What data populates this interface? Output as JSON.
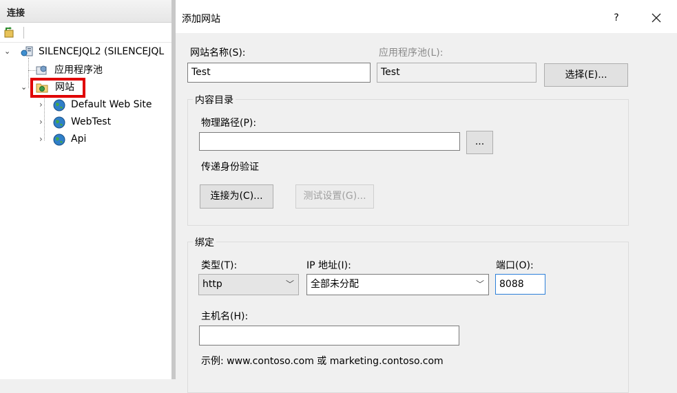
{
  "connections": {
    "header": "连接",
    "tree": {
      "server": "SILENCEJQL2 (SILENCEJQL",
      "app_pools": "应用程序池",
      "sites": "网站",
      "site_items": [
        "Default Web Site",
        "WebTest",
        "Api"
      ]
    }
  },
  "dialog": {
    "title": "添加网站",
    "help": "?",
    "close": "✕",
    "site_name_label": "网站名称(S):",
    "site_name_value": "Test",
    "app_pool_label": "应用程序池(L):",
    "app_pool_value": "Test",
    "select_button": "选择(E)...",
    "content_dir": {
      "group_title": "内容目录",
      "physical_path_label": "物理路径(P):",
      "physical_path_value": "",
      "browse_button": "...",
      "pass_auth_label": "传递身份验证",
      "connect_as_button": "连接为(C)...",
      "test_settings_button": "测试设置(G)..."
    },
    "binding": {
      "group_title": "绑定",
      "type_label": "类型(T):",
      "type_value": "http",
      "ip_label": "IP 地址(I):",
      "ip_value": "全部未分配",
      "port_label": "端口(O):",
      "port_value": "8088",
      "hostname_label": "主机名(H):",
      "hostname_value": "",
      "example": "示例: www.contoso.com 或 marketing.contoso.com"
    }
  }
}
